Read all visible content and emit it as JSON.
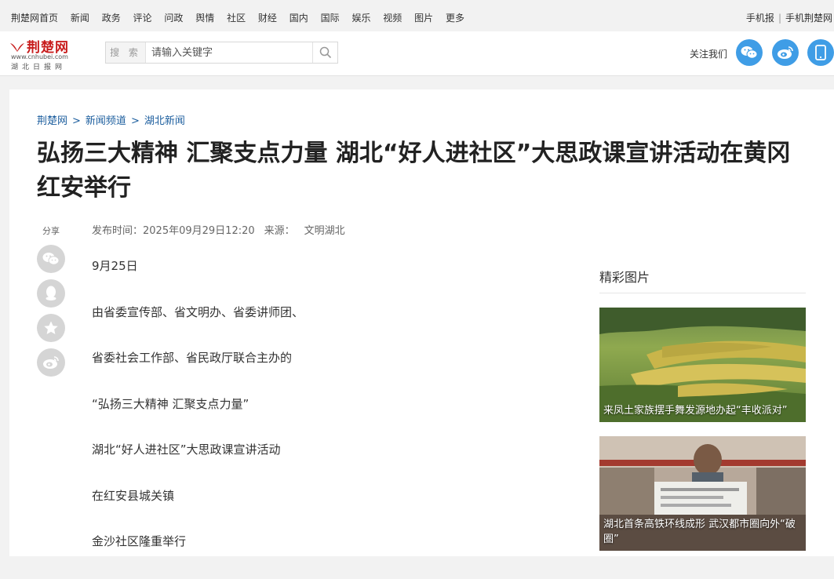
{
  "topnav": {
    "links": [
      "荆楚网首页",
      "新闻",
      "政务",
      "评论",
      "问政",
      "舆情",
      "社区",
      "财经",
      "国内",
      "国际",
      "娱乐",
      "视频",
      "图片",
      "更多"
    ],
    "right_links": [
      "手机报",
      "手机荆楚网"
    ],
    "right_separator": "|"
  },
  "header": {
    "logo_text": "荆楚网",
    "logo_url": "www.cnhubei.com",
    "logo_sub": "湖北日报网",
    "search_label": "搜 索",
    "search_placeholder": "请输入关键字",
    "follow_label": "关注我们",
    "brand_color": "#c81d1d",
    "accent_color": "#3f9de6"
  },
  "breadcrumb": {
    "items": [
      "荆楚网",
      "新闻频道",
      "湖北新闻"
    ],
    "separator": ">"
  },
  "article": {
    "title": "弘扬三大精神 汇聚支点力量 湖北“好人进社区”大思政课宣讲活动在黄冈红安举行",
    "share_label": "分享",
    "share_icons": [
      "wechat-icon",
      "qq-icon",
      "favorite-star-icon",
      "weibo-icon"
    ],
    "publish_label": "发布时间：",
    "publish_time": "2025年09月29日12:20",
    "source_label": "来源：",
    "source": "文明湖北",
    "paragraphs": [
      "9月25日",
      "由省委宣传部、省文明办、省委讲师团、",
      "省委社会工作部、省民政厅联合主办的",
      "“弘扬三大精神 汇聚支点力量”",
      "湖北“好人进社区”大思政课宣讲活动",
      "在红安县城关镇",
      "金沙社区隆重举行"
    ]
  },
  "sidebar": {
    "title": "精彩图片",
    "pictures": [
      {
        "caption": "来凤土家族摆手舞发源地办起“丰收派对”"
      },
      {
        "caption": "湖北首条高铁环线成形 武汉都市圈向外“破圈”"
      }
    ]
  }
}
